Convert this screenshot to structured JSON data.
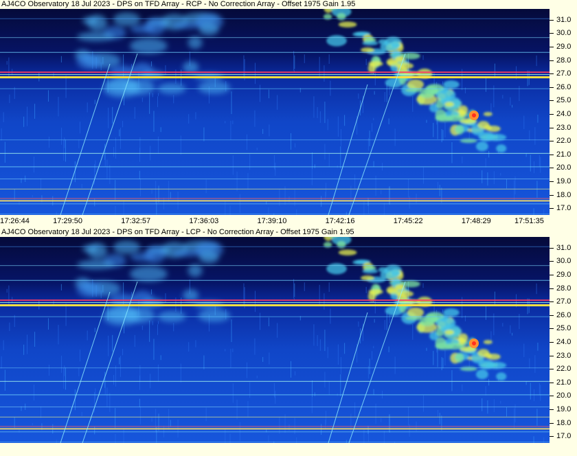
{
  "panels": [
    {
      "title": "AJ4CO Observatory 18 Jul 2023 - DPS on TFD Array  - RCP  -  No Correction Array  -  Offset 1975  Gain 1.95"
    },
    {
      "title": "AJ4CO Observatory 18 Jul 2023 - DPS on TFD Array  - LCP  -  No Correction Array  -  Offset 1975  Gain 1.95"
    }
  ],
  "colors": {
    "background": "#ffffe6",
    "low": "#05105a",
    "mid": "#1e5ae6",
    "high": "#ffff50"
  },
  "chart_data": {
    "type": "heatmap",
    "title": "AJ4CO Observatory 18 Jul 2023 - DPS on TFD Array",
    "xlabel": "",
    "ylabel": "",
    "x_tick_labels": [
      "17:26:44",
      "17:29:50",
      "17:32:57",
      "17:36:03",
      "17:39:10",
      "17:42:16",
      "17:45:22",
      "17:48:29",
      "17:51:35"
    ],
    "y_tick_labels": [
      "31.0",
      "30.0",
      "29.0",
      "28.0",
      "27.0",
      "26.0",
      "25.0",
      "24.0",
      "23.0",
      "22.0",
      "21.0",
      "20.0",
      "19.0",
      "18.0",
      "17.0"
    ],
    "ylim": [
      16.5,
      31.8
    ],
    "colormap": "blue-cyan-yellow",
    "series": [
      {
        "name": "RCP"
      },
      {
        "name": "LCP"
      }
    ]
  }
}
